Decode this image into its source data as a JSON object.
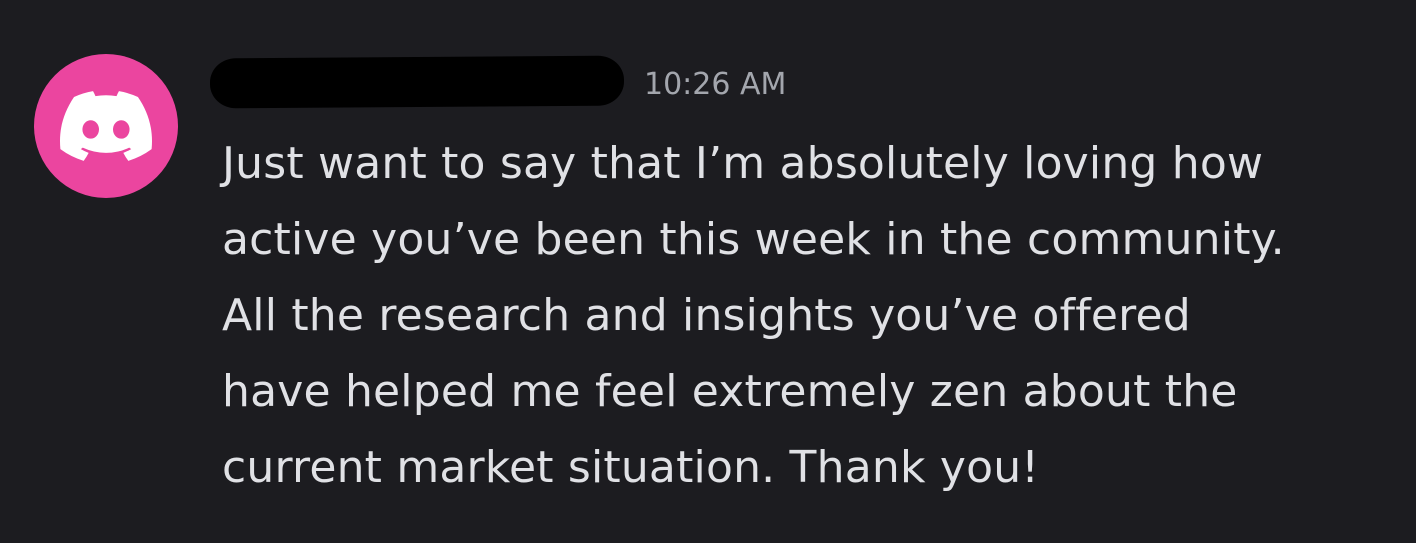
{
  "message": {
    "author_name": "",
    "timestamp": "10:26 AM",
    "avatar_icon": "discord-logo-icon",
    "avatar_color": "#eb459f",
    "content_lines": [
      "Just want to say that I’m absolutely loving how",
      "active you’ve been this week in the community.",
      "All the research and insights you’ve offered",
      "have helped me feel extremely zen about the",
      "current market situation. Thank you!"
    ]
  }
}
